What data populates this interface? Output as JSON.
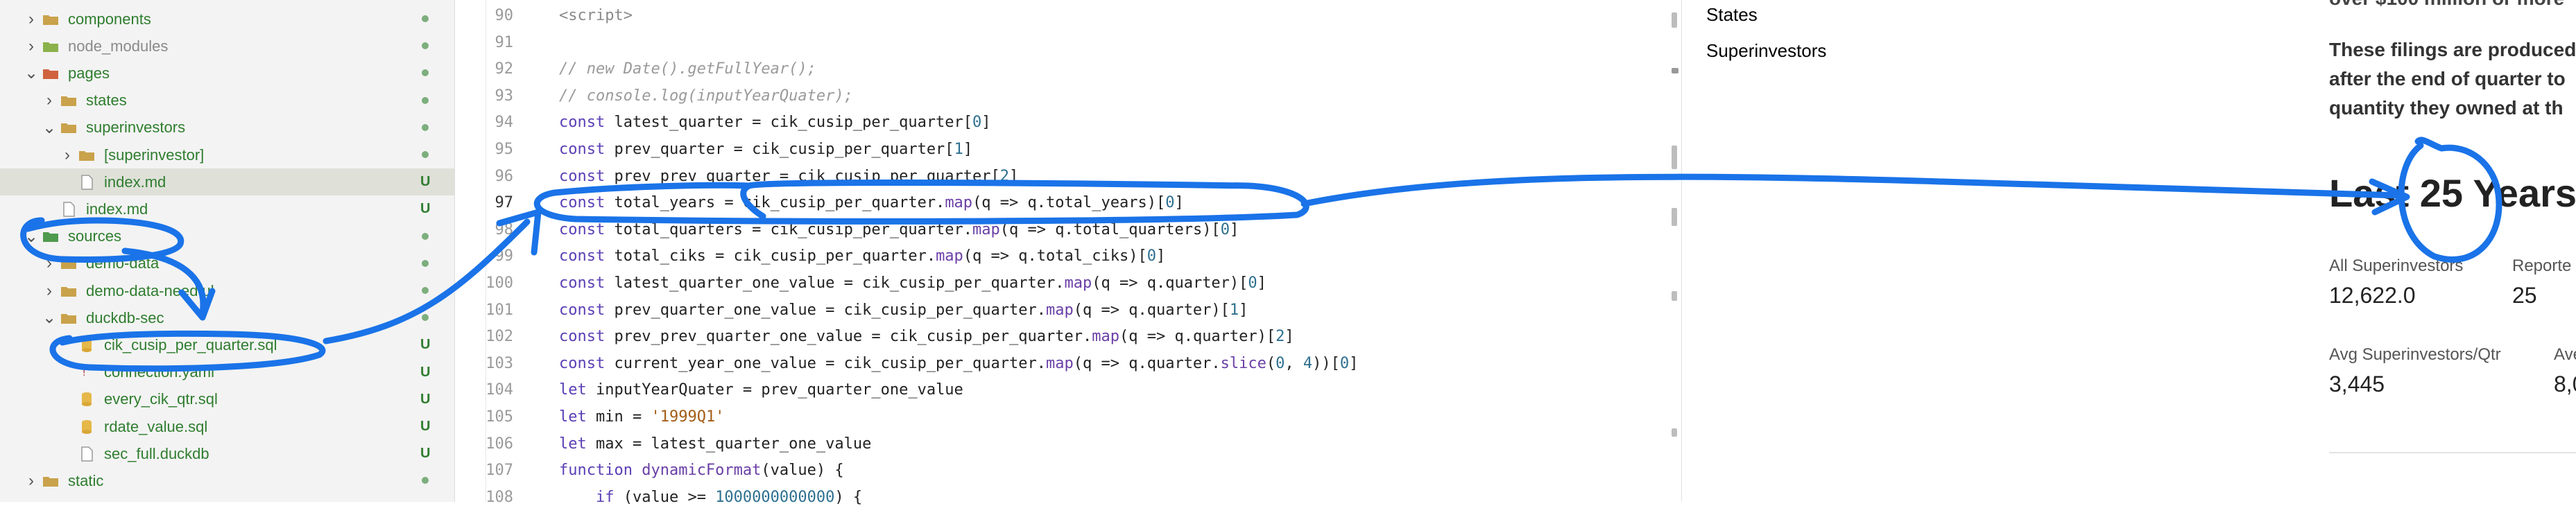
{
  "explorer": {
    "items": [
      {
        "label": "components",
        "indent": 1,
        "chevron": "›",
        "icon": "folder",
        "color": "mod",
        "badge": "dot"
      },
      {
        "label": "node_modules",
        "indent": 1,
        "chevron": "›",
        "icon": "folder-node",
        "color": "muted",
        "badge": "dot"
      },
      {
        "label": "pages",
        "indent": 1,
        "chevron": "⌄",
        "icon": "folder-red",
        "color": "mod",
        "badge": "dot"
      },
      {
        "label": "states",
        "indent": 2,
        "chevron": "›",
        "icon": "folder",
        "color": "mod",
        "badge": "dot"
      },
      {
        "label": "superinvestors",
        "indent": 2,
        "chevron": "⌄",
        "icon": "folder",
        "color": "mod",
        "badge": "dot"
      },
      {
        "label": "[superinvestor]",
        "indent": 3,
        "chevron": "›",
        "icon": "folder",
        "color": "mod",
        "badge": "dot"
      },
      {
        "label": "index.md",
        "indent": 3,
        "chevron": "",
        "icon": "file",
        "color": "mod",
        "badge": "U",
        "selected": true
      },
      {
        "label": "index.md",
        "indent": 2,
        "chevron": "",
        "icon": "file",
        "color": "mod",
        "badge": "U"
      },
      {
        "label": "sources",
        "indent": 1,
        "chevron": "⌄",
        "icon": "folder-green",
        "color": "mod",
        "badge": "dot"
      },
      {
        "label": "demo-data",
        "indent": 2,
        "chevron": "›",
        "icon": "folder",
        "color": "mod",
        "badge": "dot"
      },
      {
        "label": "demo-data-needful",
        "indent": 2,
        "chevron": "›",
        "icon": "folder",
        "color": "mod",
        "badge": "dot"
      },
      {
        "label": "duckdb-sec",
        "indent": 2,
        "chevron": "⌄",
        "icon": "folder",
        "color": "mod",
        "badge": "dot"
      },
      {
        "label": "cik_cusip_per_quarter.sql",
        "indent": 3,
        "chevron": "",
        "icon": "db",
        "color": "mod",
        "badge": "U"
      },
      {
        "label": "connection.yaml",
        "indent": 3,
        "chevron": "",
        "icon": "yaml",
        "color": "mod",
        "badge": "U"
      },
      {
        "label": "every_cik_qtr.sql",
        "indent": 3,
        "chevron": "",
        "icon": "db",
        "color": "mod",
        "badge": "U"
      },
      {
        "label": "rdate_value.sql",
        "indent": 3,
        "chevron": "",
        "icon": "db",
        "color": "mod",
        "badge": "U"
      },
      {
        "label": "sec_full.duckdb",
        "indent": 3,
        "chevron": "",
        "icon": "file",
        "color": "mod",
        "badge": "U"
      },
      {
        "label": "static",
        "indent": 1,
        "chevron": "›",
        "icon": "folder",
        "color": "mod",
        "badge": "dot"
      }
    ]
  },
  "editor": {
    "lines": [
      {
        "n": "90",
        "html": "<span class='c-tag'>&lt;script&gt;</span>"
      },
      {
        "n": "91",
        "html": ""
      },
      {
        "n": "92",
        "html": "<span class='c-com'>// new Date().getFullYear();</span>"
      },
      {
        "n": "93",
        "html": "<span class='c-com'>// console.log(inputYearQuater);</span>"
      },
      {
        "n": "94",
        "html": "<span class='c-kw'>const</span> latest_quarter = cik_cusip_per_quarter[<span class='c-num'>0</span>]"
      },
      {
        "n": "95",
        "html": "<span class='c-kw'>const</span> prev_quarter = cik_cusip_per_quarter[<span class='c-num'>1</span>]"
      },
      {
        "n": "96",
        "html": "<span class='c-kw'>const</span> prev_prev_quarter = cik_cusip_per_quarter[<span class='c-num'>2</span>]"
      },
      {
        "n": "97",
        "html": "<span class='c-kw'>const</span> total_years = cik_cusip_per_quarter.<span class='c-fn'>map</span>(q =&gt; q.total_years)[<span class='c-num'>0</span>]"
      },
      {
        "n": "98",
        "html": "<span class='c-kw'>const</span> total_quarters = cik_cusip_per_quarter.<span class='c-fn'>map</span>(q =&gt; q.total_quarters)[<span class='c-num'>0</span>]"
      },
      {
        "n": "99",
        "html": "<span class='c-kw'>const</span> total_ciks = cik_cusip_per_quarter.<span class='c-fn'>map</span>(q =&gt; q.total_ciks)[<span class='c-num'>0</span>]"
      },
      {
        "n": "100",
        "html": "<span class='c-kw'>const</span> latest_quarter_one_value = cik_cusip_per_quarter.<span class='c-fn'>map</span>(q =&gt; q.quarter)[<span class='c-num'>0</span>]"
      },
      {
        "n": "101",
        "html": "<span class='c-kw'>const</span> prev_quarter_one_value = cik_cusip_per_quarter.<span class='c-fn'>map</span>(q =&gt; q.quarter)[<span class='c-num'>1</span>]"
      },
      {
        "n": "102",
        "html": "<span class='c-kw'>const</span> prev_prev_quarter_one_value = cik_cusip_per_quarter.<span class='c-fn'>map</span>(q =&gt; q.quarter)[<span class='c-num'>2</span>]"
      },
      {
        "n": "103",
        "html": "<span class='c-kw'>const</span> current_year_one_value = cik_cusip_per_quarter.<span class='c-fn'>map</span>(q =&gt; q.quarter.<span class='c-fn'>slice</span>(<span class='c-num'>0</span>, <span class='c-num'>4</span>))[<span class='c-num'>0</span>]"
      },
      {
        "n": "104",
        "html": "<span class='c-kw'>let</span> inputYearQuater = prev_quarter_one_value"
      },
      {
        "n": "105",
        "html": "<span class='c-kw'>let</span> min = <span class='c-str'>'1999Q1'</span>"
      },
      {
        "n": "106",
        "html": "<span class='c-kw'>let</span> max = latest_quarter_one_value"
      },
      {
        "n": "107",
        "html": "<span class='c-kw'>function</span> <span class='c-fn'>dynamicFormat</span>(value) {"
      },
      {
        "n": "108",
        "html": "    <span class='c-kw'>if</span> (value &gt;= <span class='c-num'>1000000000000</span>) {"
      }
    ]
  },
  "outline": {
    "items": [
      {
        "label": "States",
        "color": "#444444"
      },
      {
        "label": "Superinvestors",
        "color": "#2b6cc4"
      }
    ]
  },
  "preview": {
    "cut_top": "over $100 million or more",
    "para_lines": [
      "These filings are produced",
      "after the end of quarter to",
      "quantity they owned at th"
    ],
    "heading": "Last 25 Years",
    "stats": [
      {
        "label": "All Superinvestors",
        "value": "12,622.0"
      },
      {
        "label": "Reporte",
        "value": "25"
      },
      {
        "label": "Avg Superinvestors/Qtr",
        "value": "3,445"
      },
      {
        "label": "Ave",
        "value": "8,0"
      }
    ]
  },
  "colors": {
    "annotation_blue": "#1a73e8"
  }
}
